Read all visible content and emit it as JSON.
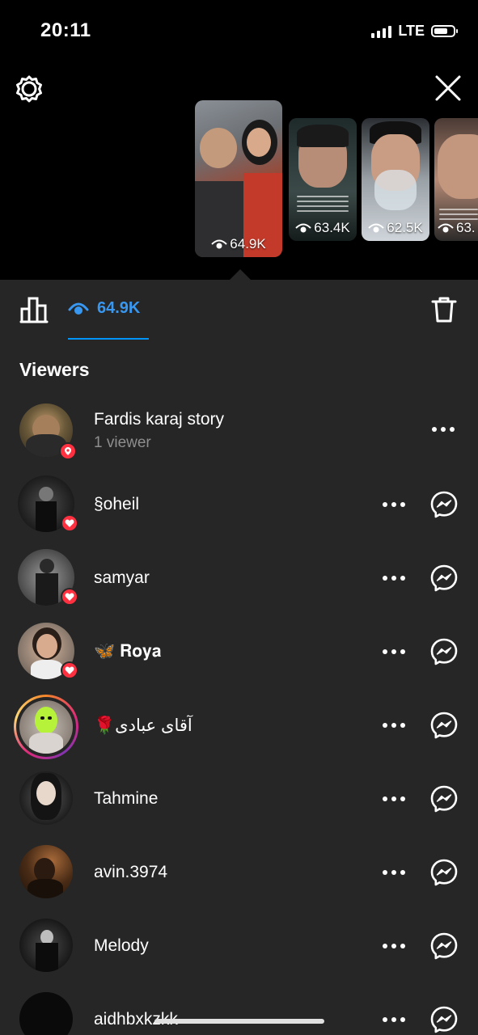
{
  "status": {
    "time": "20:11",
    "network": "LTE"
  },
  "stories": [
    {
      "views": "64.9K"
    },
    {
      "views": "63.4K"
    },
    {
      "views": "62.5K"
    },
    {
      "views": "63."
    }
  ],
  "tab": {
    "views": "64.9K"
  },
  "section_title": "Viewers",
  "viewers": [
    {
      "name": "Fardis karaj story",
      "sub": "1 viewer",
      "badge": "location"
    },
    {
      "name": "§oheil",
      "badge": "heart"
    },
    {
      "name": "samyar",
      "badge": "heart"
    },
    {
      "name": "🦋 𝐑𝐨𝐲𝐚",
      "badge": "heart"
    },
    {
      "name": "🌹آقای عبادی",
      "badge": ""
    },
    {
      "name": "Tahmine",
      "badge": ""
    },
    {
      "name": "avin.3974",
      "badge": ""
    },
    {
      "name": "Melody",
      "badge": ""
    },
    {
      "name": "aidhbxkzkk",
      "badge": ""
    }
  ],
  "colors": {
    "accent": "#0095f6",
    "heart": "#ff3040",
    "sheet": "#262626"
  }
}
